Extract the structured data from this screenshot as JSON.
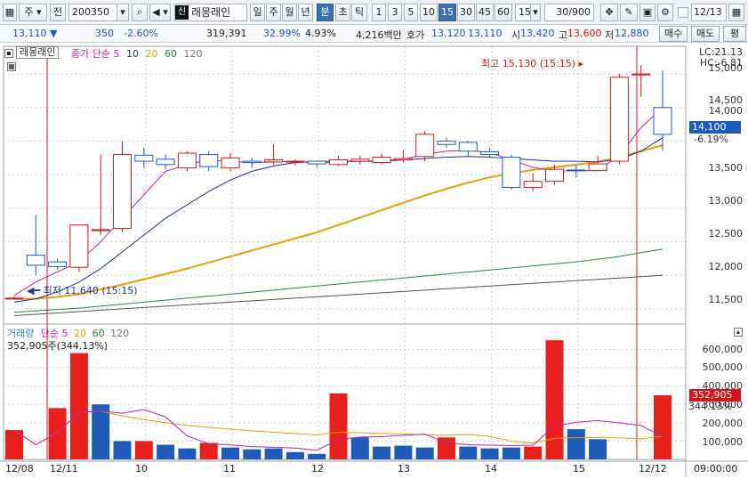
{
  "toolbar": {
    "item1": "주",
    "item2": "전",
    "code": "200350",
    "badge": "신",
    "stock_name": "래몽래인",
    "periods": [
      "일",
      "주",
      "월",
      "년",
      "분",
      "초",
      "틱"
    ],
    "period_active": "분",
    "intervals": [
      "1",
      "3",
      "5",
      "10",
      "15",
      "30",
      "45",
      "60"
    ],
    "interval_active": "15",
    "interval_select": "15",
    "count": "30/900",
    "date": "12/13"
  },
  "info": {
    "price": "13,110",
    "change": "350",
    "change_pct": "-2.60%",
    "volume": "319,391",
    "vol_ratio": "32.99%",
    "turnover_pct": "4.93%",
    "amount": "4,216백만",
    "quote_label": "호가",
    "ask": "13,120",
    "bid": "13,110",
    "open_label": "시",
    "open": "13,420",
    "high_label": "고",
    "high": "13,600",
    "low_label": "저",
    "low": "12,880",
    "buy_btn": "매수",
    "sell_btn": "매도",
    "eval_btn": "평"
  },
  "chart_data": {
    "type": "candlestick",
    "stock_name": "래몽래인",
    "ma_legend": [
      "종가 단순 5",
      "10",
      "20",
      "60",
      "120"
    ],
    "ma_colors": {
      "ma5": "#c020b0",
      "ma10": "#1a2f8a",
      "ma20": "#e8a000",
      "ma60": "#1f8a3a",
      "ma120": "#555555"
    },
    "y_ticks": [
      "15,000",
      "14,500",
      "14,000",
      "13,500",
      "13,000",
      "12,500",
      "12,000",
      "11,500"
    ],
    "lc_label": "LC:21.13",
    "hc_label": "HC:-6.81",
    "current_price": "14,100",
    "current_pct": "-6.19%",
    "max_annotation": "최고 15,130 (15:15)",
    "min_annotation": "최저 11,640 (15:15)",
    "candles": [
      {
        "o": 11660,
        "h": 11690,
        "l": 11640,
        "c": 11660
      },
      {
        "o": 12300,
        "h": 12900,
        "l": 12000,
        "c": 12150
      },
      {
        "o": 12200,
        "h": 12250,
        "l": 12080,
        "c": 12130
      },
      {
        "o": 12120,
        "h": 12550,
        "l": 12050,
        "c": 12750
      },
      {
        "o": 12680,
        "h": 13800,
        "l": 12600,
        "c": 12680
      },
      {
        "o": 12700,
        "h": 14000,
        "l": 12650,
        "c": 13800
      },
      {
        "o": 13790,
        "h": 13900,
        "l": 13600,
        "c": 13700
      },
      {
        "o": 13730,
        "h": 13800,
        "l": 13580,
        "c": 13650
      },
      {
        "o": 13600,
        "h": 13850,
        "l": 13550,
        "c": 13820
      },
      {
        "o": 13800,
        "h": 13850,
        "l": 13550,
        "c": 13620
      },
      {
        "o": 13600,
        "h": 13820,
        "l": 13550,
        "c": 13750
      },
      {
        "o": 13700,
        "h": 13750,
        "l": 13600,
        "c": 13680
      },
      {
        "o": 13690,
        "h": 13950,
        "l": 13650,
        "c": 13720
      },
      {
        "o": 13690,
        "h": 13730,
        "l": 13640,
        "c": 13700
      },
      {
        "o": 13700,
        "h": 13700,
        "l": 13600,
        "c": 13660
      },
      {
        "o": 13650,
        "h": 13780,
        "l": 13630,
        "c": 13720
      },
      {
        "o": 13700,
        "h": 13780,
        "l": 13650,
        "c": 13730
      },
      {
        "o": 13680,
        "h": 13810,
        "l": 13650,
        "c": 13760
      },
      {
        "o": 13720,
        "h": 13870,
        "l": 13680,
        "c": 13740
      },
      {
        "o": 13770,
        "h": 14150,
        "l": 13700,
        "c": 14100
      },
      {
        "o": 14000,
        "h": 14050,
        "l": 13900,
        "c": 13950
      },
      {
        "o": 13980,
        "h": 14000,
        "l": 13780,
        "c": 13850
      },
      {
        "o": 13840,
        "h": 13900,
        "l": 13780,
        "c": 13800
      },
      {
        "o": 13760,
        "h": 13800,
        "l": 13280,
        "c": 13310
      },
      {
        "o": 13310,
        "h": 13520,
        "l": 13250,
        "c": 13400
      },
      {
        "o": 13400,
        "h": 13650,
        "l": 13350,
        "c": 13580
      },
      {
        "o": 13570,
        "h": 13650,
        "l": 13460,
        "c": 13560
      },
      {
        "o": 13560,
        "h": 13780,
        "l": 13550,
        "c": 13660
      },
      {
        "o": 13700,
        "h": 15000,
        "l": 13650,
        "c": 14950
      },
      {
        "o": 15000,
        "h": 15130,
        "l": 14660,
        "c": 15000
      },
      {
        "o": 14500,
        "h": 15050,
        "l": 13860,
        "c": 14100
      }
    ],
    "ma5": [
      11700,
      11900,
      12050,
      12200,
      12500,
      12850,
      13200,
      13550,
      13650,
      13720,
      13700,
      13680,
      13690,
      13700,
      13670,
      13690,
      13700,
      13710,
      13730,
      13800,
      13850,
      13860,
      13830,
      13720,
      13610,
      13550,
      13560,
      13560,
      13790,
      14200,
      14500
    ],
    "ma10": [
      11600,
      11650,
      11750,
      11900,
      12100,
      12350,
      12600,
      12850,
      13050,
      13250,
      13420,
      13550,
      13630,
      13680,
      13700,
      13700,
      13700,
      13700,
      13720,
      13740,
      13760,
      13770,
      13760,
      13740,
      13720,
      13700,
      13700,
      13690,
      13730,
      13850,
      14050
    ],
    "ma20": [
      11650,
      11650,
      11680,
      11720,
      11790,
      11860,
      11940,
      12020,
      12100,
      12190,
      12280,
      12370,
      12460,
      12550,
      12640,
      12750,
      12860,
      12970,
      13080,
      13190,
      13290,
      13380,
      13460,
      13520,
      13570,
      13610,
      13650,
      13690,
      13760,
      13850,
      13940
    ],
    "ma60": [
      11450,
      11470,
      11490,
      11510,
      11540,
      11570,
      11600,
      11630,
      11660,
      11690,
      11720,
      11750,
      11780,
      11810,
      11840,
      11870,
      11900,
      11930,
      11960,
      11990,
      12020,
      12050,
      12080,
      12110,
      12140,
      12170,
      12200,
      12240,
      12280,
      12340,
      12390
    ],
    "ma120": [
      11400,
      11420,
      11440,
      11460,
      11480,
      11500,
      11520,
      11540,
      11560,
      11580,
      11600,
      11620,
      11640,
      11660,
      11680,
      11700,
      11720,
      11740,
      11760,
      11780,
      11800,
      11820,
      11840,
      11860,
      11880,
      11900,
      11920,
      11940,
      11960,
      11980,
      12000
    ],
    "volume_legend": {
      "label": "거래량",
      "ma_label": "단순 5",
      "p2": "20",
      "p3": "60",
      "p4": "120"
    },
    "volume_caption": "352,905주(344.13%)",
    "volume_ticks": [
      "600,000",
      "500,000",
      "400,000",
      "300,000",
      "200,000",
      "100,000"
    ],
    "volume_current": "352,905",
    "volume_pct": "344.13%",
    "volumes": [
      160000,
      0,
      280000,
      580000,
      300000,
      100000,
      100000,
      80000,
      60000,
      90000,
      65000,
      55000,
      60000,
      40000,
      30000,
      360000,
      120000,
      70000,
      75000,
      65000,
      120000,
      70000,
      60000,
      65000,
      70000,
      650000,
      165000,
      110000,
      0,
      0,
      350000
    ],
    "volume_up": [
      true,
      false,
      true,
      true,
      false,
      false,
      true,
      false,
      false,
      true,
      false,
      false,
      false,
      false,
      false,
      true,
      false,
      false,
      false,
      false,
      true,
      false,
      false,
      false,
      true,
      true,
      false,
      false,
      false,
      false,
      true
    ],
    "date_labels": [
      "12/08",
      "12/11",
      "10",
      "11",
      "12",
      "13",
      "14",
      "15",
      "12/12"
    ],
    "time_label": "09:00:00"
  }
}
